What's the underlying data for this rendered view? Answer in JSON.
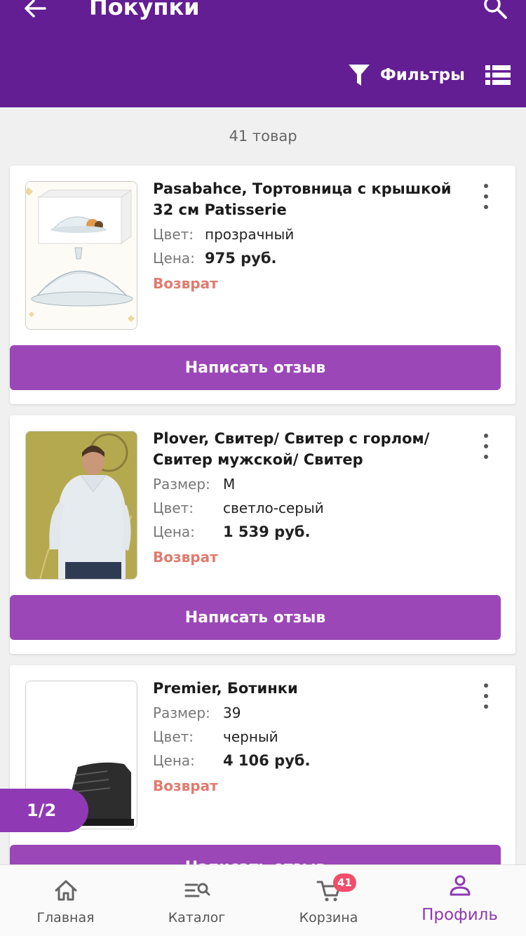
{
  "header": {
    "title": "Покупки",
    "filter_label": "Фильтры"
  },
  "summary": {
    "count_text": "41 товар"
  },
  "products": [
    {
      "name": "Pasabahce, Тортовница с крышкой 32 см  Patisserie",
      "attributes": [
        {
          "label": "Цвет:",
          "value": "прозрачный"
        },
        {
          "label": "Цена:",
          "value": "975 руб."
        }
      ],
      "status": "Возврат",
      "review_label": "Написать отзыв"
    },
    {
      "name": "Plover, Свитер/ Свитер с горлом/ Свитер мужской/ Свитер",
      "attributes": [
        {
          "label": "Размер:",
          "value": "M"
        },
        {
          "label": "Цвет:",
          "value": "светло-серый"
        },
        {
          "label": "Цена:",
          "value": "1 539 руб."
        }
      ],
      "status": "Возврат",
      "review_label": "Написать отзыв"
    },
    {
      "name": "Premier, Ботинки",
      "attributes": [
        {
          "label": "Размер:",
          "value": "39"
        },
        {
          "label": "Цвет:",
          "value": "черный"
        },
        {
          "label": "Цена:",
          "value": "4 106 руб."
        }
      ],
      "status": "Возврат",
      "review_label": "Написать отзыв"
    }
  ],
  "pager": {
    "text": "1/2"
  },
  "bottom_nav": {
    "items": [
      {
        "label": "Главная",
        "icon": "home-icon"
      },
      {
        "label": "Каталог",
        "icon": "catalog-search-icon"
      },
      {
        "label": "Корзина",
        "icon": "cart-icon",
        "badge": "41"
      },
      {
        "label": "Профиль",
        "icon": "profile-icon",
        "active": true
      }
    ]
  },
  "colors": {
    "header_bg": "#621e92",
    "accent": "#9b47b7",
    "return_text": "#e07b6e",
    "badge": "#f04e6b"
  }
}
